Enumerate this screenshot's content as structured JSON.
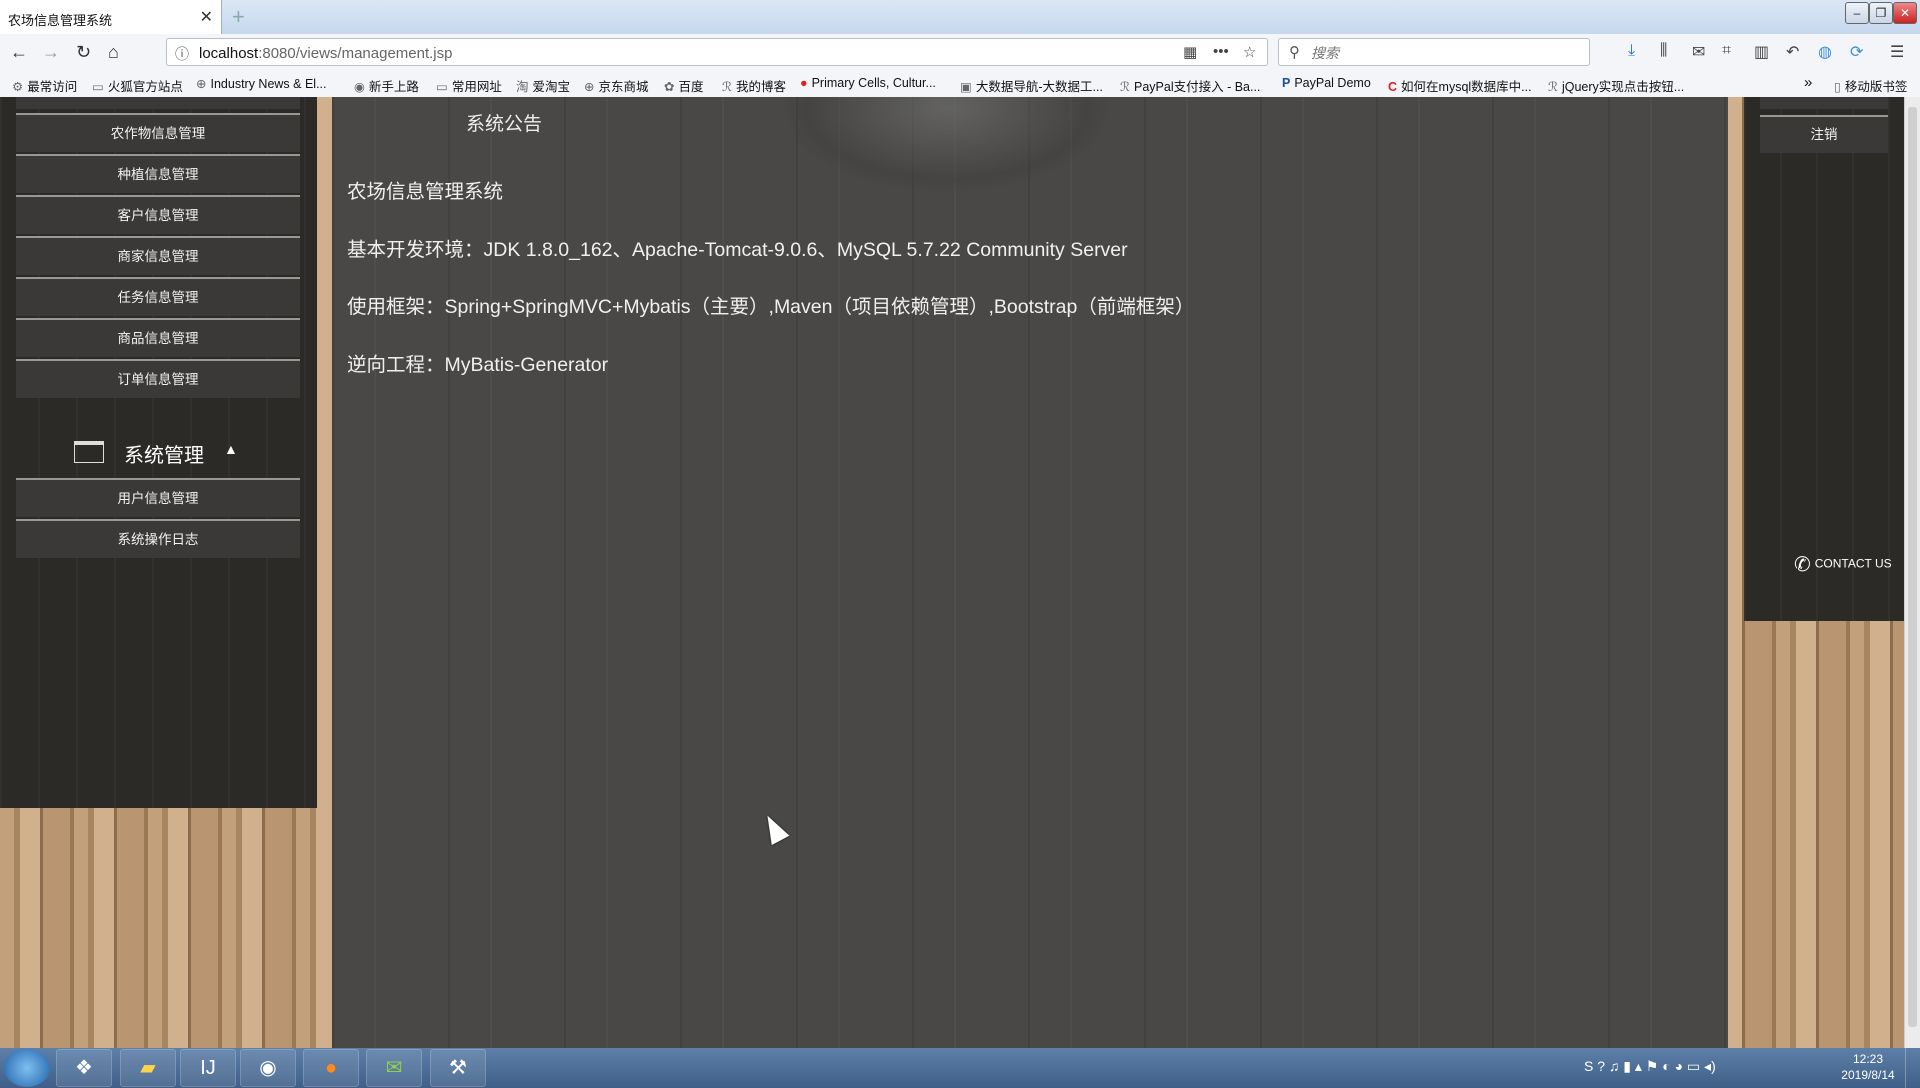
{
  "browser": {
    "tab_title": "农场信息管理系统",
    "tab_close": "✕",
    "new_tab": "+",
    "url_prefix": "localhost",
    "url_rest": ":8080/views/management.jsp",
    "search_placeholder": "搜索",
    "window_buttons": [
      "–",
      "❐",
      "✕"
    ]
  },
  "bookmarks": [
    {
      "icon": "⚙",
      "label": "最常访问"
    },
    {
      "icon": "▭",
      "label": "火狐官方站点"
    },
    {
      "icon": "⊕",
      "label": "Industry News & El..."
    },
    {
      "icon": "◉",
      "label": "新手上路"
    },
    {
      "icon": "▭",
      "label": "常用网址"
    },
    {
      "icon": "淘",
      "label": "爱淘宝"
    },
    {
      "icon": "⊕",
      "label": "京东商城"
    },
    {
      "icon": "✿",
      "label": "百度"
    },
    {
      "icon": "ℛ",
      "label": "我的博客"
    },
    {
      "icon": "●",
      "label": "Primary Cells, Cultur..."
    },
    {
      "icon": "▣",
      "label": "大数据导航-大数据工..."
    },
    {
      "icon": "ℛ",
      "label": "PayPal支付接入 - Ba..."
    },
    {
      "icon": "P",
      "label": "PayPal Demo"
    },
    {
      "icon": "C",
      "label": "如何在mysql数据库中..."
    },
    {
      "icon": "ℛ",
      "label": "jQuery实现点击按钮..."
    }
  ],
  "bookmarks_overflow": "»",
  "mobile_bookmarks": "移动版书签",
  "sidebar": {
    "items": [
      "农作物信息管理",
      "种植信息管理",
      "客户信息管理",
      "商家信息管理",
      "任务信息管理",
      "商品信息管理",
      "订单信息管理"
    ],
    "group_title": "系统管理",
    "group_caret": "▲",
    "group_items": [
      "用户信息管理",
      "系统操作日志"
    ]
  },
  "main": {
    "notice_title": "系统公告",
    "lines": [
      "农场信息管理系统",
      "基本开发环境：JDK 1.8.0_162、Apache-Tomcat-9.0.6、MySQL 5.7.22 Community Server",
      "使用框架：Spring+SpringMVC+Mybatis（主要）,Maven（项目依赖管理）,Bootstrap（前端框架）",
      "逆向工程：MyBatis-Generator"
    ]
  },
  "right_panel": {
    "logout": "注销",
    "contact": "CONTACT US"
  },
  "taskbar": {
    "apps": [
      "explorer-icon",
      "intellij-icon",
      "eclipse-icon",
      "firefox-icon",
      "wechat-icon",
      "tool-icon"
    ],
    "tray": "S ? ♫ ▮ ▴ ⚑ ◐ ◕ ▭ ◂)",
    "time": "12:23",
    "date": "2019/8/14"
  }
}
